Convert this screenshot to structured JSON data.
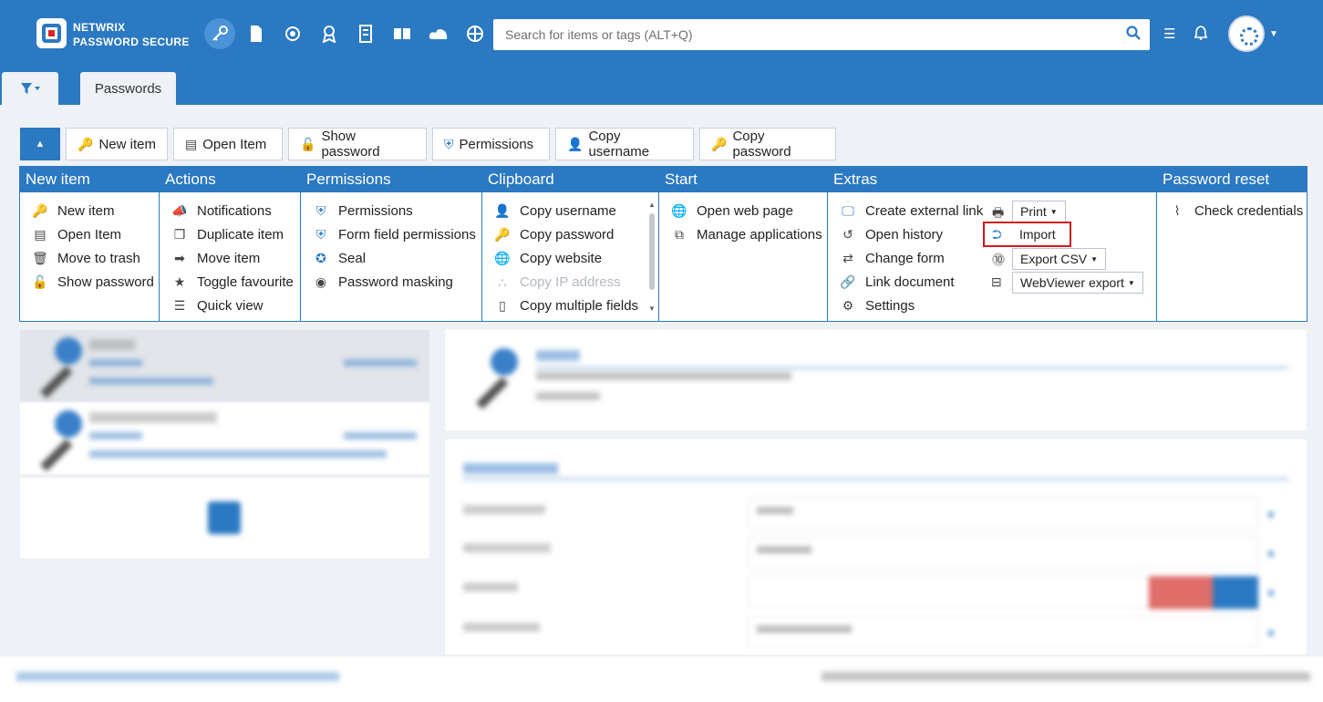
{
  "brand": {
    "line1": "NETWRIX",
    "line2": "PASSWORD SECURE"
  },
  "search": {
    "placeholder": "Search for items or tags (ALT+Q)"
  },
  "tabs": {
    "active": "Passwords"
  },
  "toolbar": {
    "new_item": "New item",
    "open_item": "Open Item",
    "show_password": "Show password",
    "permissions": "Permissions",
    "copy_username": "Copy username",
    "copy_password": "Copy password"
  },
  "ribbon": {
    "new_item": {
      "title": "New item",
      "items": [
        "New item",
        "Open Item",
        "Move to trash",
        "Show password"
      ]
    },
    "actions": {
      "title": "Actions",
      "items": [
        "Notifications",
        "Duplicate item",
        "Move item",
        "Toggle favourite",
        "Quick view"
      ]
    },
    "permissions": {
      "title": "Permissions",
      "items": [
        "Permissions",
        "Form field permissions",
        "Seal",
        "Password masking"
      ]
    },
    "clipboard": {
      "title": "Clipboard",
      "items": [
        "Copy username",
        "Copy password",
        "Copy website",
        "Copy IP address",
        "Copy multiple fields"
      ]
    },
    "start": {
      "title": "Start",
      "items": [
        "Open web page",
        "Manage applications"
      ]
    },
    "extras": {
      "title": "Extras",
      "items": [
        "Create external link",
        "Open history",
        "Change form",
        "Link document",
        "Settings"
      ],
      "print": "Print",
      "import": "Import",
      "export_csv": "Export CSV",
      "webviewer_export": "WebViewer export"
    },
    "password_reset": {
      "title": "Password reset",
      "items": [
        "Check credentials"
      ]
    }
  }
}
